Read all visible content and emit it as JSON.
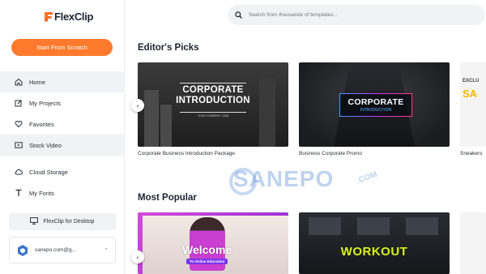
{
  "app": {
    "logo_text": "FlexClip",
    "accent": "#ff7a2d"
  },
  "sidebar": {
    "start_button": "Start From Scratch",
    "items": [
      {
        "label": "Home",
        "icon": "home-icon",
        "active": true
      },
      {
        "label": "My Projects",
        "icon": "edit-icon"
      },
      {
        "label": "Favorites",
        "icon": "heart-icon"
      },
      {
        "label": "Stock Video",
        "icon": "video-icon"
      },
      {
        "label": "Cloud Storage",
        "icon": "cloud-icon"
      },
      {
        "label": "My Fonts",
        "icon": "font-icon"
      }
    ],
    "desktop_button": "FlexClip for Desktop",
    "user_email": "sanepo.com@g..."
  },
  "search": {
    "placeholder": "Search from thousands of templates..."
  },
  "editors_picks": {
    "title": "Editor's Picks",
    "cards": [
      {
        "caption": "Corporate Business Introduction Package",
        "thumb_title_line1": "CORPORATE",
        "thumb_title_line2": "INTRODUCTION",
        "thumb_sub": "YOUR COMPANY .COM"
      },
      {
        "caption": "Business Corporate Promo",
        "thumb_title": "CORPORATE",
        "thumb_sub": "INTRODUCTION"
      },
      {
        "caption": "Sneakers",
        "thumb_text_a": "EXCLU",
        "thumb_text_b": "SA"
      }
    ]
  },
  "most_popular": {
    "title": "Most Popular",
    "cards": [
      {
        "thumb_title": "Welcome",
        "thumb_sub": "To Online Education"
      },
      {
        "thumb_title": "WORKOUT"
      },
      {
        "thumb_title": ""
      }
    ]
  },
  "watermark": {
    "text": "SANEPO",
    "suffix": ".COM"
  }
}
